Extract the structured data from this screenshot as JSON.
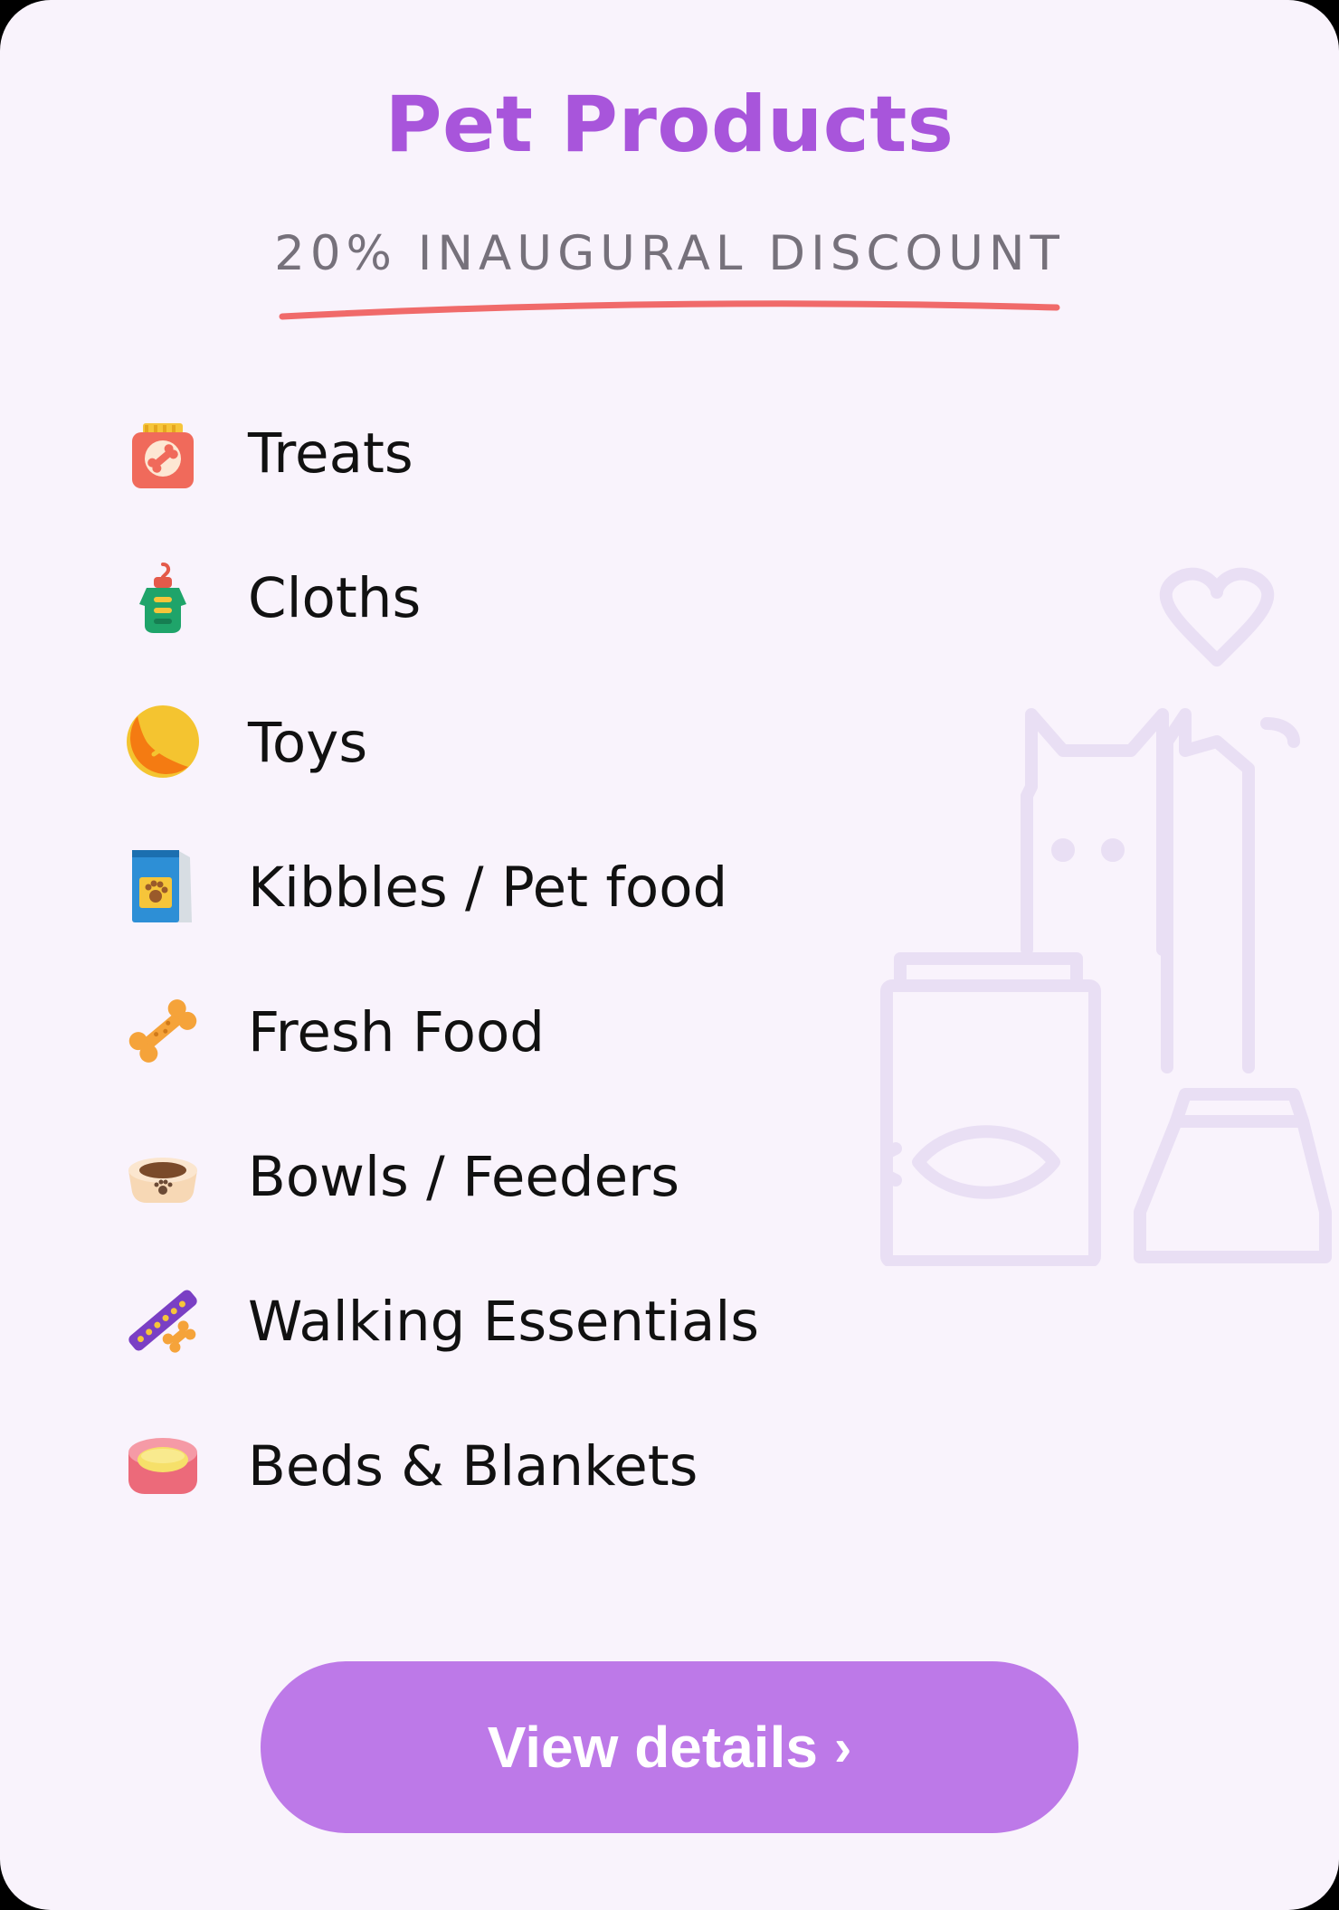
{
  "card": {
    "title": "Pet Products",
    "subtitle": "20% INAUGURAL DISCOUNT",
    "accent_color": "#a855db",
    "underline_color": "#f06a6a"
  },
  "items": [
    {
      "label": "Treats",
      "icon": "treat-bag-icon"
    },
    {
      "label": "Cloths",
      "icon": "pet-sweater-icon"
    },
    {
      "label": "Toys",
      "icon": "tennis-ball-icon"
    },
    {
      "label": "Kibbles / Pet food",
      "icon": "kibble-bag-icon"
    },
    {
      "label": "Fresh Food",
      "icon": "bone-icon"
    },
    {
      "label": "Bowls / Feeders",
      "icon": "pet-bowl-icon"
    },
    {
      "label": "Walking Essentials",
      "icon": "collar-icon"
    },
    {
      "label": "Beds & Blankets",
      "icon": "pet-bed-icon"
    }
  ],
  "button": {
    "label": "View details",
    "chevron": "›",
    "color": "#bd79e8"
  }
}
